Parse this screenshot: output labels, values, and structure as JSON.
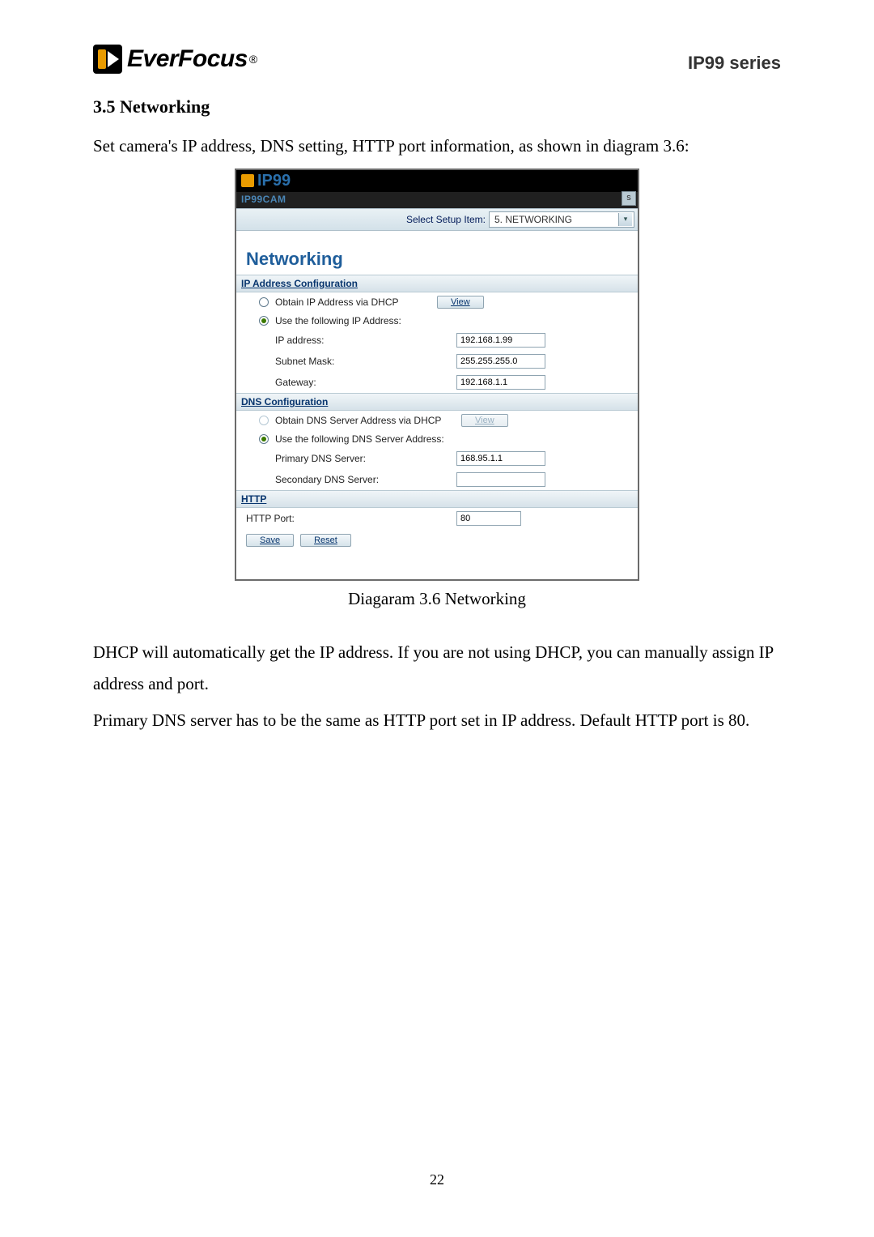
{
  "header": {
    "brand": "EverFocus",
    "series": "IP99 series"
  },
  "section": {
    "heading": "3.5 Networking",
    "intro": "Set camera's IP address, DNS setting, HTTP port information, as shown in diagram 3.6:",
    "caption": "Diagaram 3.6 Networking",
    "para2": "DHCP will automatically get the IP address. If you are not using DHCP, you can manually assign IP address and port.",
    "para3": "Primary DNS server has to be the same as HTTP port set in IP address. Default HTTP port is 80."
  },
  "app": {
    "title": "IP99",
    "subtitle": "IP99CAM",
    "corner_btn": "s",
    "select_label": "Select Setup Item:",
    "select_value": "5. NETWORKING",
    "panel_title": "Networking",
    "ipconf": {
      "heading": "IP Address Configuration",
      "opt_dhcp": "Obtain IP Address via DHCP",
      "view_btn": "View",
      "opt_static": "Use the following IP Address:",
      "ip_label": "IP address:",
      "ip_value": "192.168.1.99",
      "mask_label": "Subnet Mask:",
      "mask_value": "255.255.255.0",
      "gw_label": "Gateway:",
      "gw_value": "192.168.1.1"
    },
    "dnsconf": {
      "heading": "DNS Configuration",
      "opt_dhcp": "Obtain DNS Server Address via DHCP",
      "view_btn": "View",
      "opt_static": "Use the following DNS Server Address:",
      "primary_label": "Primary DNS Server:",
      "primary_value": "168.95.1.1",
      "secondary_label": "Secondary DNS Server:",
      "secondary_value": ""
    },
    "http": {
      "heading": "HTTP",
      "port_label": "HTTP Port:",
      "port_value": "80"
    },
    "save_btn": "Save",
    "reset_btn": "Reset"
  },
  "page_number": "22"
}
